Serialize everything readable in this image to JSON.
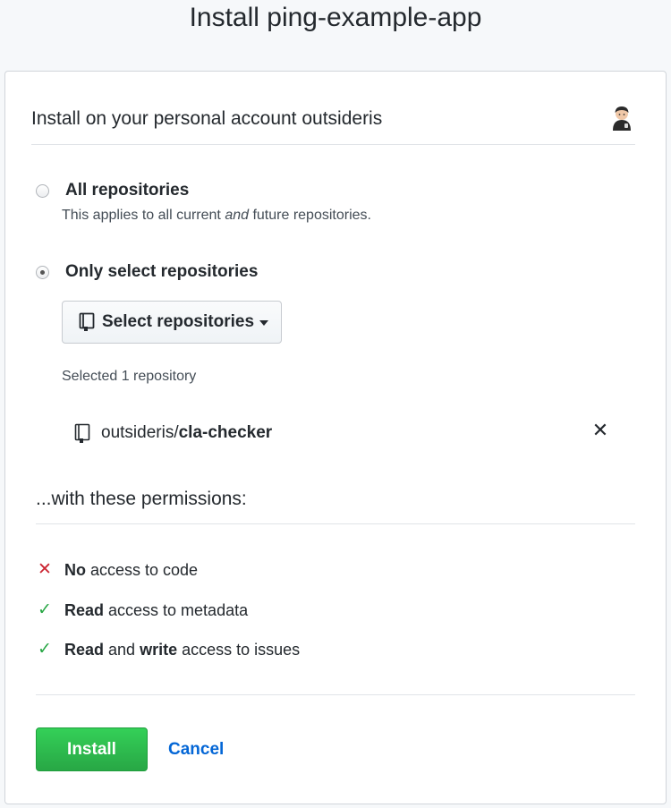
{
  "page": {
    "title": "Install ping-example-app"
  },
  "account": {
    "heading": "Install on your personal account outsideris"
  },
  "options": [
    {
      "label": "All repositories",
      "desc_before": "This applies to all current ",
      "desc_em": "and",
      "desc_after": " future repositories.",
      "checked": false
    },
    {
      "label": "Only select repositories",
      "checked": true
    }
  ],
  "select_button": {
    "label": "Select repositories",
    "icon": "repo-icon"
  },
  "selected": {
    "count_text": "Selected 1 repository",
    "repos": [
      {
        "owner": "outsideris/",
        "name": "cla-checker",
        "remove": "✕"
      }
    ]
  },
  "permissions": {
    "title": "...with these permissions:",
    "items": [
      {
        "icon": "x-icon",
        "glyph": "✕",
        "parts": [
          {
            "b": "No"
          },
          {
            "t": " access to code"
          }
        ]
      },
      {
        "icon": "check-icon",
        "glyph": "✓",
        "parts": [
          {
            "b": "Read"
          },
          {
            "t": " access to metadata"
          }
        ]
      },
      {
        "icon": "check-icon",
        "glyph": "✓",
        "parts": [
          {
            "b": "Read"
          },
          {
            "t": " and "
          },
          {
            "b": "write"
          },
          {
            "t": " access to issues"
          }
        ]
      }
    ]
  },
  "actions": {
    "install_label": "Install",
    "cancel_label": "Cancel"
  },
  "colors": {
    "primary_green": "#28a745",
    "link_blue": "#0366d6",
    "error_red": "#cb2431"
  }
}
